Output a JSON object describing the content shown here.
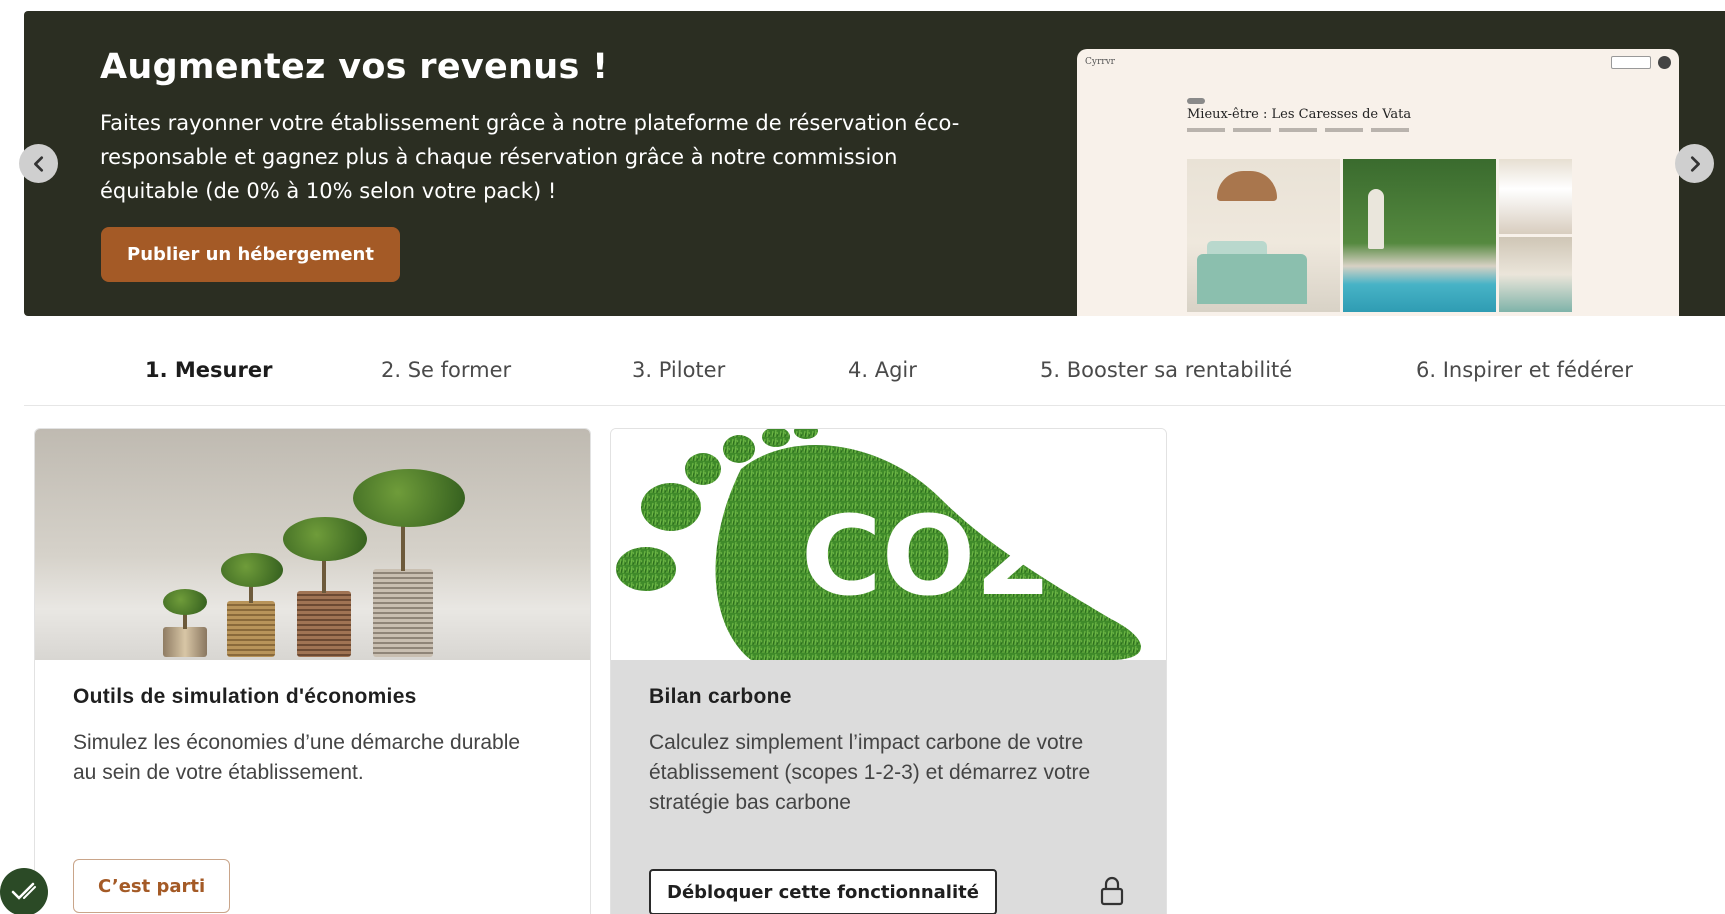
{
  "banner": {
    "title": "Augmentez vos revenus !",
    "text": "Faites rayonner votre établissement grâce à notre plateforme de réservation éco-responsable et gagnez plus à chaque réservation grâce à notre commission équitable (de 0% à 10% selon votre pack) !",
    "cta_label": "Publier un hébergement",
    "preview": {
      "logo": "Cyrrvr",
      "listing_title": "Mieux-être : Les Caresses de Vata"
    }
  },
  "tabs": [
    {
      "label": "1. Mesurer",
      "active": true
    },
    {
      "label": "2. Se former",
      "active": false
    },
    {
      "label": "3. Piloter",
      "active": false
    },
    {
      "label": "4. Agir",
      "active": false
    },
    {
      "label": "5. Booster sa rentabilité",
      "active": false
    },
    {
      "label": "6. Inspirer et fédérer",
      "active": false
    }
  ],
  "cards": [
    {
      "title": "Outils de simulation d'économies",
      "description": "Simulez les économies d’une démarche durable au sein de votre établissement.",
      "button_label": "C’est parti",
      "locked": false
    },
    {
      "title": "Bilan carbone",
      "description": "Calculez simplement l’impact carbone de votre établissement (scopes 1-2-3) et démarrez votre stratégie bas carbone",
      "button_label": "Débloquer cette fonctionnalité",
      "locked": true,
      "image_text": "CO2"
    }
  ],
  "colors": {
    "banner_bg": "#2b2e22",
    "accent": "#a45a26",
    "locked_card_bg": "#dcdcdc"
  },
  "icons": [
    "chevron-left-icon",
    "chevron-right-icon",
    "lock-icon",
    "checkmark-badge-icon"
  ]
}
